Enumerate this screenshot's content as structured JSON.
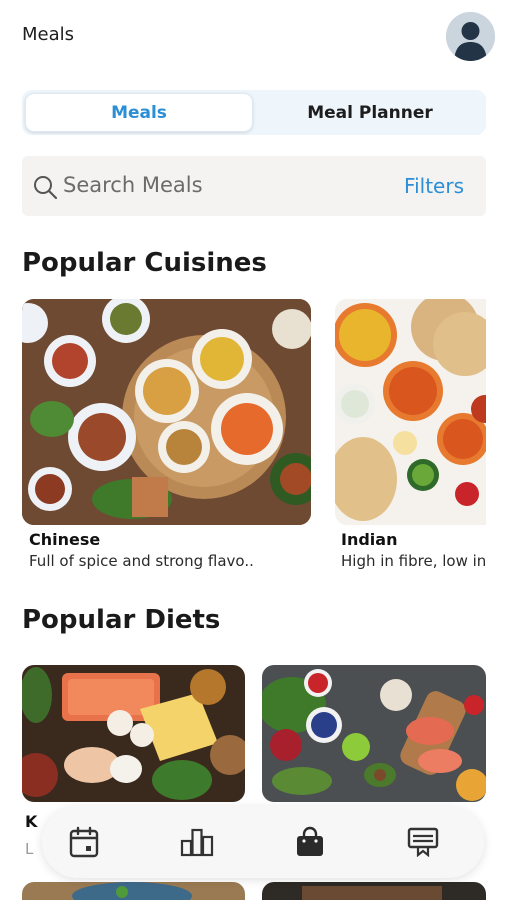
{
  "header": {
    "title": "Meals",
    "avatar_icon": "user-avatar-icon"
  },
  "tabs": [
    {
      "label": "Meals",
      "active": true
    },
    {
      "label": "Meal Planner",
      "active": false
    }
  ],
  "search": {
    "placeholder": "Search Meals",
    "filters_label": "Filters",
    "icon": "search-icon"
  },
  "cuisines": {
    "title": "Popular Cuisines",
    "items": [
      {
        "name": "Chinese",
        "description": "Full of spice and strong flavo.."
      },
      {
        "name": "Indian",
        "description": "High in fibre, low in"
      }
    ]
  },
  "diets": {
    "title": "Popular Diets",
    "items": [
      {
        "name": "K",
        "description": "L"
      },
      {
        "name": "",
        "description": ""
      }
    ]
  },
  "bottom_nav": [
    {
      "icon": "calendar-icon"
    },
    {
      "icon": "bar-chart-icon"
    },
    {
      "icon": "shopping-bag-icon",
      "active": true
    },
    {
      "icon": "recipe-board-icon"
    }
  ],
  "colors": {
    "accent": "#2b8fd6",
    "tab_background": "#eef5fb",
    "search_background": "#f4f3f2"
  }
}
